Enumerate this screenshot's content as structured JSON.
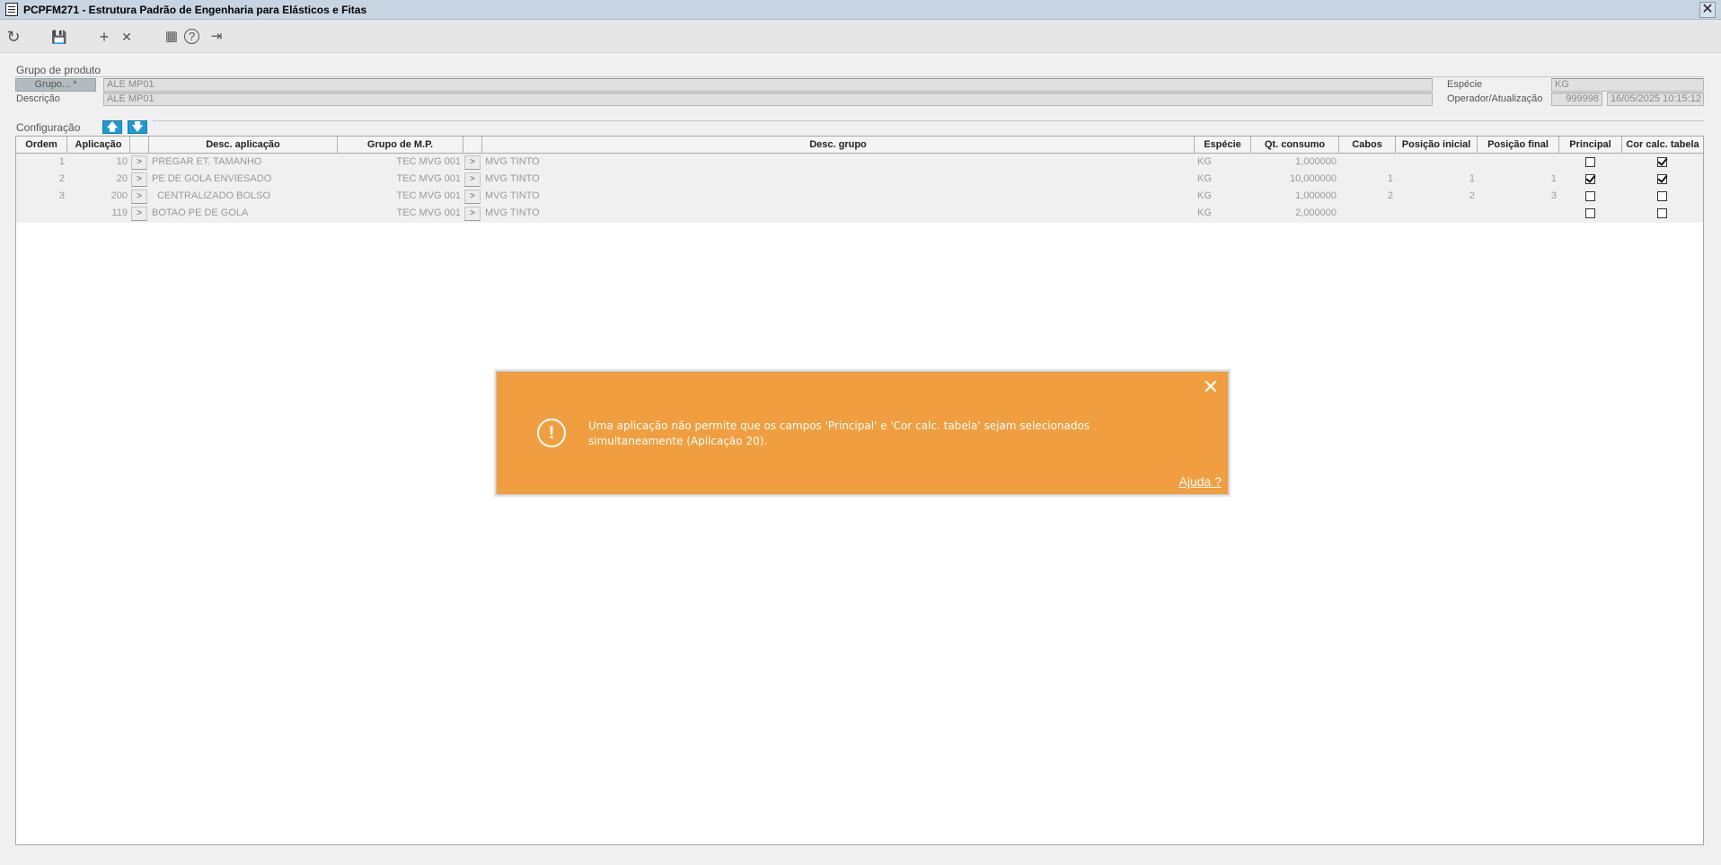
{
  "window": {
    "title": "PCPFM271 - Estrutura Padrão de Engenharia para Elásticos e Fitas",
    "close_glyph": "✕"
  },
  "toolbar": {
    "refresh_icon": "↻",
    "save_icon": "💾",
    "add_icon": "+",
    "delete_icon": "✕",
    "calendar_icon": "▦",
    "help_icon": "?",
    "exit_icon": "⇥"
  },
  "grupo_produto": {
    "section_label": "Grupo de produto",
    "grupo_button": "Grupo... *",
    "grupo_value": "ALE MP01",
    "descricao_label": "Descrição",
    "descricao_value": "ALE MP01",
    "especie_label": "Espécie",
    "especie_value": "KG",
    "operador_label": "Operador/Atualização",
    "operador_value": "999998",
    "atualizacao_value": "16/05/2025 10:15:12"
  },
  "configuracao": {
    "section_label": "Configuração",
    "up_icon": "🡅",
    "down_icon": "🡇"
  },
  "grid": {
    "headers": {
      "ordem": "Ordem",
      "aplicacao": "Aplicação",
      "desc_aplicacao": "Desc. aplicação",
      "grupo_mp": "Grupo de M.P.",
      "desc_grupo": "Desc. grupo",
      "especie": "Espécie",
      "qt_consumo": "Qt. consumo",
      "cabos": "Cabos",
      "posicao_inicial": "Posição inicial",
      "posicao_final": "Posição final",
      "principal": "Principal",
      "cor_calc_tabela": "Cor calc. tabela"
    },
    "arrow_label": ">",
    "rows": [
      {
        "ordem": "1",
        "aplicacao": "10",
        "desc_aplicacao": "PREGAR ET. TAMANHO",
        "grupo_mp": "TEC MVG 001",
        "desc_grupo": "MVG TINTO",
        "especie": "KG",
        "qt_consumo": "1,000000",
        "cabos": "",
        "posicao_inicial": "",
        "posicao_final": "",
        "principal": false,
        "cor_calc_tabela": true
      },
      {
        "ordem": "2",
        "aplicacao": "20",
        "desc_aplicacao": "PE DE GOLA ENVIESADO",
        "grupo_mp": "TEC MVG 001",
        "desc_grupo": "MVG TINTO",
        "especie": "KG",
        "qt_consumo": "10,000000",
        "cabos": "1",
        "posicao_inicial": "1",
        "posicao_final": "1",
        "principal": true,
        "cor_calc_tabela": true
      },
      {
        "ordem": "3",
        "aplicacao": "200",
        "desc_aplicacao": "  CENTRALIZADO BOLSO",
        "grupo_mp": "TEC MVG 001",
        "desc_grupo": "MVG TINTO",
        "especie": "KG",
        "qt_consumo": "1,000000",
        "cabos": "2",
        "posicao_inicial": "2",
        "posicao_final": "3",
        "principal": false,
        "cor_calc_tabela": false
      },
      {
        "ordem": "",
        "aplicacao": "119",
        "desc_aplicacao": "BOTAO PE DE GOLA",
        "grupo_mp": "TEC MVG 001",
        "desc_grupo": "MVG TINTO",
        "especie": "KG",
        "qt_consumo": "2,000000",
        "cabos": "",
        "posicao_inicial": "",
        "posicao_final": "",
        "principal": false,
        "cor_calc_tabela": false
      }
    ]
  },
  "toast": {
    "message_line1": "Uma aplicação não permite que os campos 'Principal' e 'Cor calc. tabela' sejam selecionados",
    "message_line2": "simultaneamente (Aplicação 20).",
    "help_link": "Ajuda ?",
    "close_glyph": "✕",
    "alert_glyph": "!",
    "color": "#f09e3f"
  }
}
